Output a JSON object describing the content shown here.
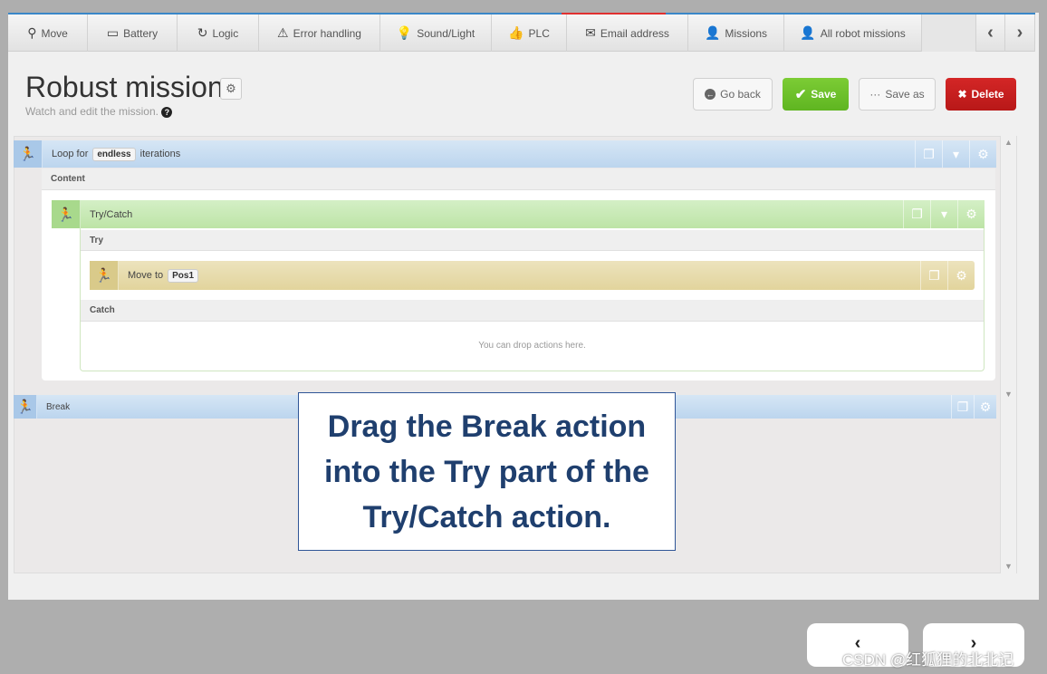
{
  "tabs": [
    {
      "label": "Move",
      "icon": "location-pin-icon",
      "glyph": "⚲"
    },
    {
      "label": "Battery",
      "icon": "battery-icon",
      "glyph": "▭"
    },
    {
      "label": "Logic",
      "icon": "loop-arrow-icon",
      "glyph": "↻"
    },
    {
      "label": "Error handling",
      "icon": "warning-icon",
      "glyph": "⚠"
    },
    {
      "label": "Sound/Light",
      "icon": "lightbulb-icon",
      "glyph": "💡"
    },
    {
      "label": "PLC",
      "icon": "thumbs-up-icon",
      "glyph": "👍"
    },
    {
      "label": "Email address",
      "icon": "envelope-icon",
      "glyph": "✉"
    },
    {
      "label": "Missions",
      "icon": "user-icon",
      "glyph": "👤"
    },
    {
      "label": "All robot missions",
      "icon": "robot-user-icon",
      "glyph": "👤"
    }
  ],
  "tab_nav": {
    "prev": "‹",
    "next": "›"
  },
  "header": {
    "title": "Robust mission",
    "subtitle": "Watch and edit the mission.",
    "help": "?"
  },
  "buttons": {
    "go_back": "Go back",
    "save": "Save",
    "save_as": "Save as",
    "delete": "Delete"
  },
  "colors": {
    "save": "#6cbf2a",
    "delete": "#c81e1e",
    "loop": "#bcd5ee",
    "try_catch": "#bde4a6",
    "move": "#e2d49c",
    "callout_text": "#1f3f6e"
  },
  "mission": {
    "loop": {
      "prefix": "Loop for",
      "value": "endless",
      "suffix": "iterations",
      "content_label": "Content"
    },
    "try_catch": {
      "label": "Try/Catch",
      "try_label": "Try",
      "catch_label": "Catch",
      "drop_hint": "You can drop actions here."
    },
    "move": {
      "prefix": "Move to",
      "value": "Pos1"
    },
    "break": {
      "label": "Break"
    }
  },
  "callout": "Drag the Break action into the Try part of the Try/Catch action.",
  "slide_nav": {
    "prev": "‹",
    "next": "›"
  },
  "watermark": "CSDN @红狐狸的北北记"
}
